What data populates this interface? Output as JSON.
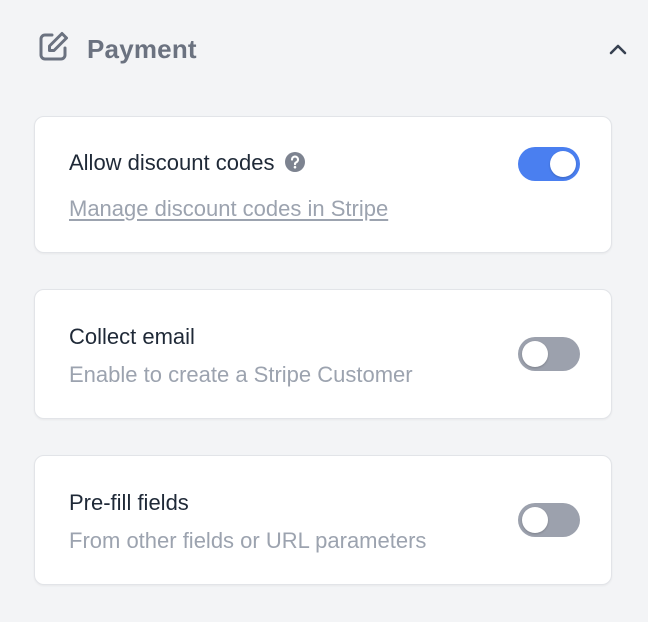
{
  "section": {
    "title": "Payment",
    "icon": "edit-icon",
    "collapse_icon": "chevron-up-icon"
  },
  "settings": [
    {
      "title": "Allow discount codes",
      "help_icon": "question-circle-icon",
      "link": "Manage discount codes in Stripe",
      "enabled": true
    },
    {
      "title": "Collect email",
      "description": "Enable to create a Stripe Customer",
      "enabled": false
    },
    {
      "title": "Pre-fill fields",
      "description": "From other fields or URL parameters",
      "enabled": false
    }
  ],
  "colors": {
    "toggle_on": "#4a7ff0",
    "toggle_off": "#9ca1ad",
    "header_text": "#6b7280",
    "muted_text": "#9ca3af"
  }
}
